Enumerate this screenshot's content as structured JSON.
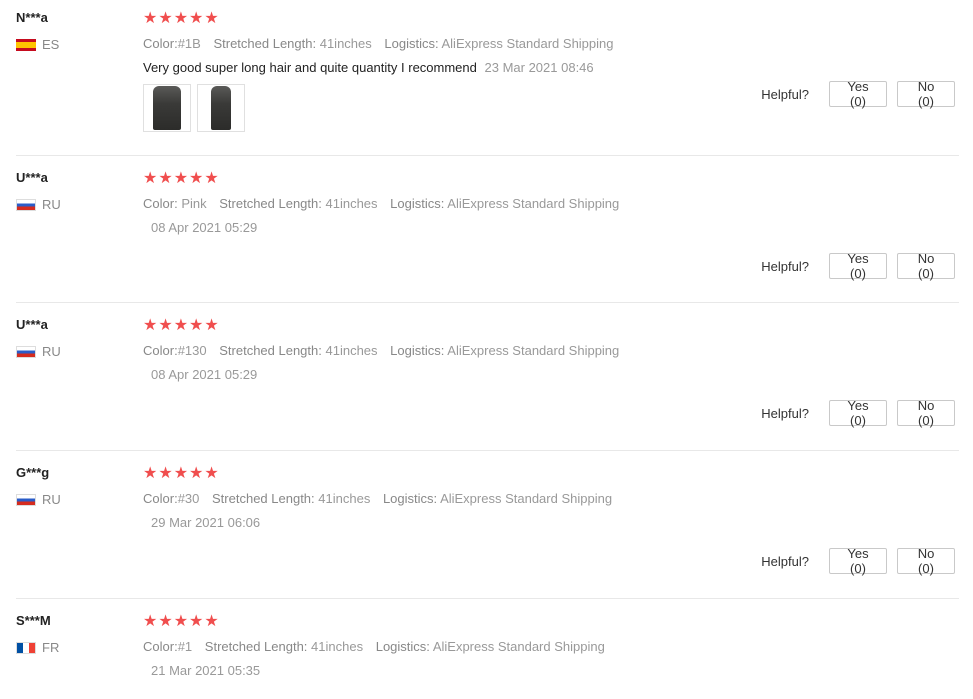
{
  "reviews": [
    {
      "user": "N***a",
      "country": "ES",
      "flag": "spain-flag-icon",
      "rating": 5,
      "attributes": [
        {
          "key": "Color:",
          "value": "#1B"
        },
        {
          "key": "Stretched Length:",
          "value": "41inches"
        },
        {
          "key": "Logistics:",
          "value": "AliExpress Standard Shipping"
        }
      ],
      "text": "Very good super long hair and quite quantity I recommend",
      "date": "23 Mar 2021 08:46",
      "helpful_label": "Helpful?",
      "yes_label": "Yes (0)",
      "no_label": "No (0)"
    },
    {
      "user": "U***a",
      "country": "RU",
      "flag": "russia-flag-icon",
      "rating": 5,
      "attributes": [
        {
          "key": "Color:",
          "value": "Pink"
        },
        {
          "key": "Stretched Length:",
          "value": "41inches"
        },
        {
          "key": "Logistics:",
          "value": "AliExpress Standard Shipping"
        }
      ],
      "date": "08 Apr 2021 05:29",
      "helpful_label": "Helpful?",
      "yes_label": "Yes (0)",
      "no_label": "No (0)"
    },
    {
      "user": "U***a",
      "country": "RU",
      "flag": "russia-flag-icon",
      "rating": 5,
      "attributes": [
        {
          "key": "Color:",
          "value": "#130"
        },
        {
          "key": "Stretched Length:",
          "value": "41inches"
        },
        {
          "key": "Logistics:",
          "value": "AliExpress Standard Shipping"
        }
      ],
      "date": "08 Apr 2021 05:29",
      "helpful_label": "Helpful?",
      "yes_label": "Yes (0)",
      "no_label": "No (0)"
    },
    {
      "user": "G***g",
      "country": "RU",
      "flag": "russia-flag-icon",
      "rating": 5,
      "attributes": [
        {
          "key": "Color:",
          "value": "#30"
        },
        {
          "key": "Stretched Length:",
          "value": "41inches"
        },
        {
          "key": "Logistics:",
          "value": "AliExpress Standard Shipping"
        }
      ],
      "date": "29 Mar 2021 06:06",
      "helpful_label": "Helpful?",
      "yes_label": "Yes (0)",
      "no_label": "No (0)"
    },
    {
      "user": "S***M",
      "country": "FR",
      "flag": "france-flag-icon",
      "rating": 5,
      "attributes": [
        {
          "key": "Color:",
          "value": "#1"
        },
        {
          "key": "Stretched Length:",
          "value": "41inches"
        },
        {
          "key": "Logistics:",
          "value": "AliExpress Standard Shipping"
        }
      ],
      "date": "21 Mar 2021 05:35"
    }
  ],
  "star_glyph": "★",
  "colors": {
    "star": "#f04e4e",
    "meta_text": "#999999",
    "border": "#e8e8e8"
  }
}
